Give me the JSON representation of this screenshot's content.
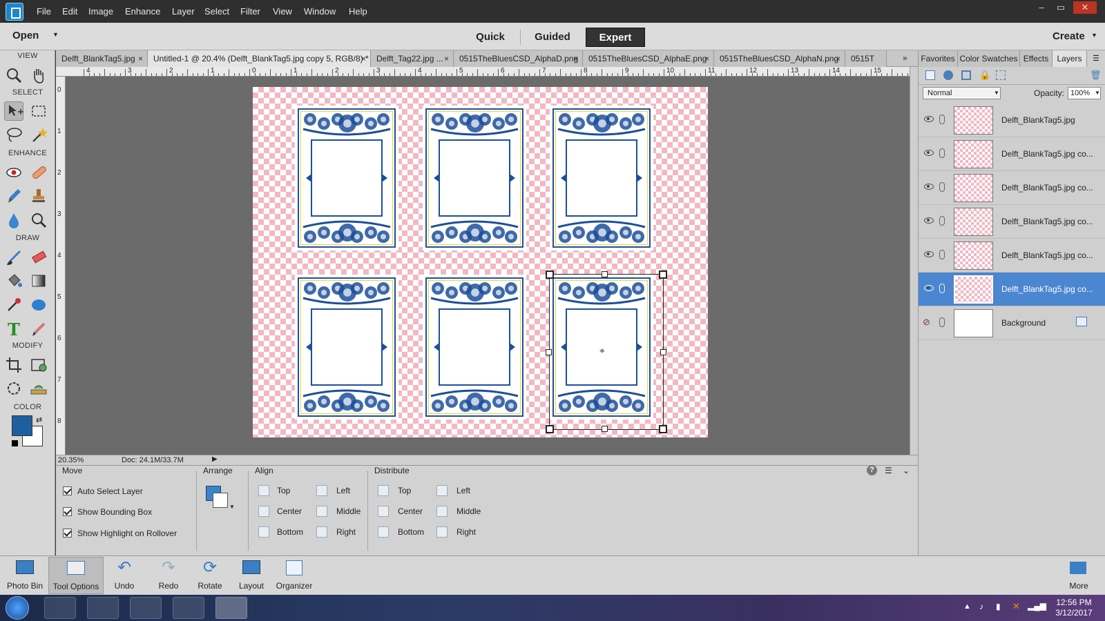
{
  "menubar": {
    "items": [
      "File",
      "Edit",
      "Image",
      "Enhance",
      "Layer",
      "Select",
      "Filter",
      "View",
      "Window",
      "Help"
    ],
    "window_controls": [
      "–",
      "▭",
      "✕"
    ]
  },
  "modebar": {
    "open_label": "Open",
    "modes": [
      "Quick",
      "Guided",
      "Expert"
    ],
    "active_mode": "Expert",
    "create_label": "Create"
  },
  "toolbox": {
    "sections": [
      "VIEW",
      "SELECT",
      "ENHANCE",
      "DRAW",
      "MODIFY",
      "COLOR"
    ],
    "tools": [
      "zoom-tool",
      "hand-tool",
      "move-tool",
      "marquee-tool",
      "lasso-tool",
      "magic-wand-tool",
      "red-eye-tool",
      "healing-brush-tool",
      "smart-brush-tool",
      "clone-stamp-tool",
      "blur-tool",
      "sponge-tool",
      "brush-tool",
      "eraser-tool",
      "paint-bucket-tool",
      "gradient-tool",
      "eyedropper-tool",
      "shape-tool",
      "type-tool",
      "pencil-tool",
      "crop-tool",
      "recompose-tool",
      "content-aware-move-tool",
      "straighten-tool"
    ],
    "foreground_color": "#1f5fa0",
    "background_color": "#ffffff"
  },
  "doc_tabs": [
    "Delft_BlankTag5.jpg",
    "Untitled-1 @ 20.4% (Delft_BlankTag5.jpg copy 5, RGB/8) *",
    "Delft_Tag22.jpg ...",
    "0515TheBluesCSD_AlphaD.png",
    "0515TheBluesCSD_AlphaE.png",
    "0515TheBluesCSD_AlphaN.png",
    "0515T"
  ],
  "active_tab": 1,
  "ruler": {
    "h": [
      "4",
      "3",
      "2",
      "1",
      "0",
      "1",
      "2",
      "3",
      "4",
      "5",
      "6",
      "7",
      "8",
      "9",
      "10",
      "11",
      "12",
      "13",
      "14",
      "15"
    ],
    "v": [
      "0",
      "1",
      "2",
      "3",
      "4",
      "5",
      "6",
      "7",
      "8"
    ]
  },
  "status": {
    "zoom": "20.35%",
    "doc": "Doc: 24.1M/33.7M"
  },
  "options": {
    "tool_name": "Move",
    "checkboxes": [
      {
        "label": "Auto Select Layer",
        "checked": true
      },
      {
        "label": "Show Bounding Box",
        "checked": true
      },
      {
        "label": "Show Highlight on Rollover",
        "checked": true
      }
    ],
    "arrange_label": "Arrange",
    "align_label": "Align",
    "distribute_label": "Distribute",
    "align": [
      "Top",
      "Center",
      "Bottom",
      "Left",
      "Middle",
      "Right"
    ],
    "distribute": [
      "Top",
      "Center",
      "Bottom",
      "Left",
      "Middle",
      "Right"
    ],
    "help": "?"
  },
  "panel": {
    "tabs": [
      "Favorites",
      "Color Swatches",
      "Effects",
      "Layers"
    ],
    "active_tab": "Layers",
    "blend_mode": "Normal",
    "opacity_label": "Opacity:",
    "opacity_value": "100%",
    "layers": [
      {
        "name": "Delft_BlankTag5.jpg"
      },
      {
        "name": "Delft_BlankTag5.jpg co..."
      },
      {
        "name": "Delft_BlankTag5.jpg co..."
      },
      {
        "name": "Delft_BlankTag5.jpg co..."
      },
      {
        "name": "Delft_BlankTag5.jpg co..."
      },
      {
        "name": "Delft_BlankTag5.jpg co...",
        "selected": true
      },
      {
        "name": "Background"
      }
    ]
  },
  "bottombar": {
    "items": [
      "Photo Bin",
      "Tool Options",
      "Undo",
      "Redo",
      "Rotate",
      "Layout",
      "Organizer"
    ],
    "more": "More"
  },
  "taskbar": {
    "time": "12:56 PM",
    "date": "3/12/2017"
  },
  "colors": {
    "accent_blue": "#1d4f9a",
    "tag_yellow": "#e8d43a",
    "checker_pink": "#f2b8c4",
    "layer_selected": "#4b86d0"
  }
}
